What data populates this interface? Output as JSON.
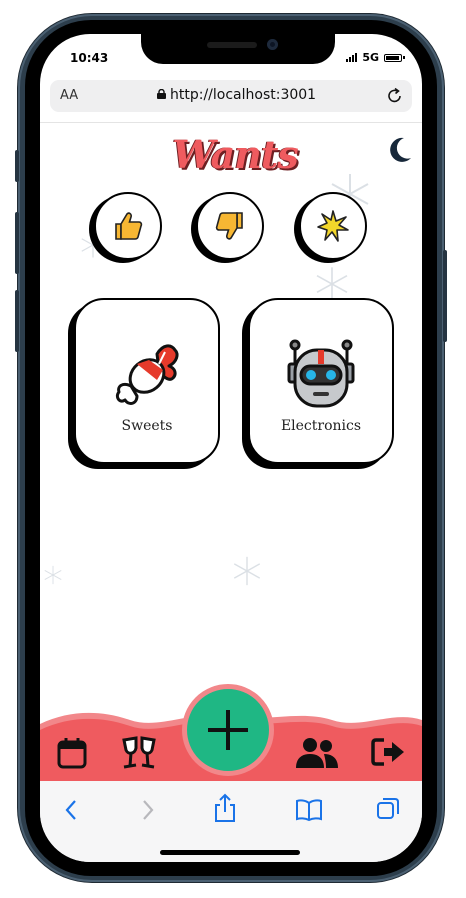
{
  "status_bar": {
    "time": "10:43",
    "network": "5G",
    "battery_level": 0.9
  },
  "browser": {
    "text_size_label": "AA",
    "url": "http://localhost:3001"
  },
  "app": {
    "title": "Wants",
    "filter_buttons": [
      {
        "icon": "thumbs-up-icon"
      },
      {
        "icon": "thumbs-down-icon"
      },
      {
        "icon": "star-burst-icon"
      }
    ],
    "categories": [
      {
        "label": "Sweets",
        "icon": "candy-icon"
      },
      {
        "label": "Electronics",
        "icon": "robot-icon"
      }
    ]
  },
  "bottom_nav": {
    "items": [
      "calendar-icon",
      "cheers-icon",
      "add-icon",
      "users-icon",
      "logout-icon"
    ],
    "accent": "#ef5b5f",
    "fab_color": "#1fb784"
  }
}
